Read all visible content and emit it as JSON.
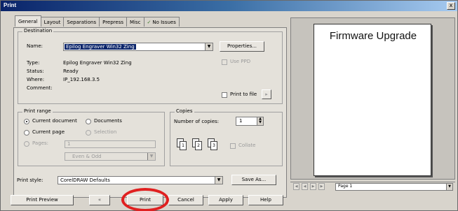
{
  "window": {
    "title": "Print",
    "close_glyph": "x"
  },
  "tabs": [
    {
      "label": "General",
      "active": true
    },
    {
      "label": "Layout"
    },
    {
      "label": "Separations"
    },
    {
      "label": "Prepress"
    },
    {
      "label": "Misc"
    },
    {
      "label": "No Issues",
      "icon": "check-icon"
    }
  ],
  "destination": {
    "group_label": "Destination",
    "name_label": "Name:",
    "name_value": "Epilog Engraver Win32 Zing",
    "properties_button": "Properties...",
    "use_ppd_label": "Use PPD",
    "type_label": "Type:",
    "type_value": "Epilog Engraver Win32 Zing",
    "status_label": "Status:",
    "status_value": "Ready",
    "where_label": "Where:",
    "where_value": "IP_192.168.3.5",
    "comment_label": "Comment:",
    "comment_value": "",
    "print_to_file_label": "Print to file",
    "file_options_glyph": "▸"
  },
  "print_range": {
    "group_label": "Print range",
    "current_document": "Current document",
    "documents": "Documents",
    "current_page": "Current page",
    "selection": "Selection",
    "pages_label": "Pages:",
    "pages_value": "1",
    "parity_value": "Even & Odd"
  },
  "copies": {
    "group_label": "Copies",
    "number_label": "Number of copies:",
    "number_value": "1",
    "collate_label": "Collate",
    "collate_pages": [
      "1",
      "2",
      "3"
    ]
  },
  "print_style": {
    "label": "Print style:",
    "value": "CorelDRAW Defaults",
    "save_as_button": "Save As..."
  },
  "bottom_buttons": {
    "print_preview": "Print Preview",
    "preview_toggle_icon": "double-arrow-icon",
    "print": "Print",
    "cancel": "Cancel",
    "apply": "Apply",
    "help": "Help"
  },
  "preview": {
    "page_text": "Firmware Upgrade",
    "page_selector": "Page 1"
  },
  "colors": {
    "highlight_ring": "#e02020",
    "title_bar": "#0a246a",
    "dialog_bg": "#d8d4cc"
  }
}
